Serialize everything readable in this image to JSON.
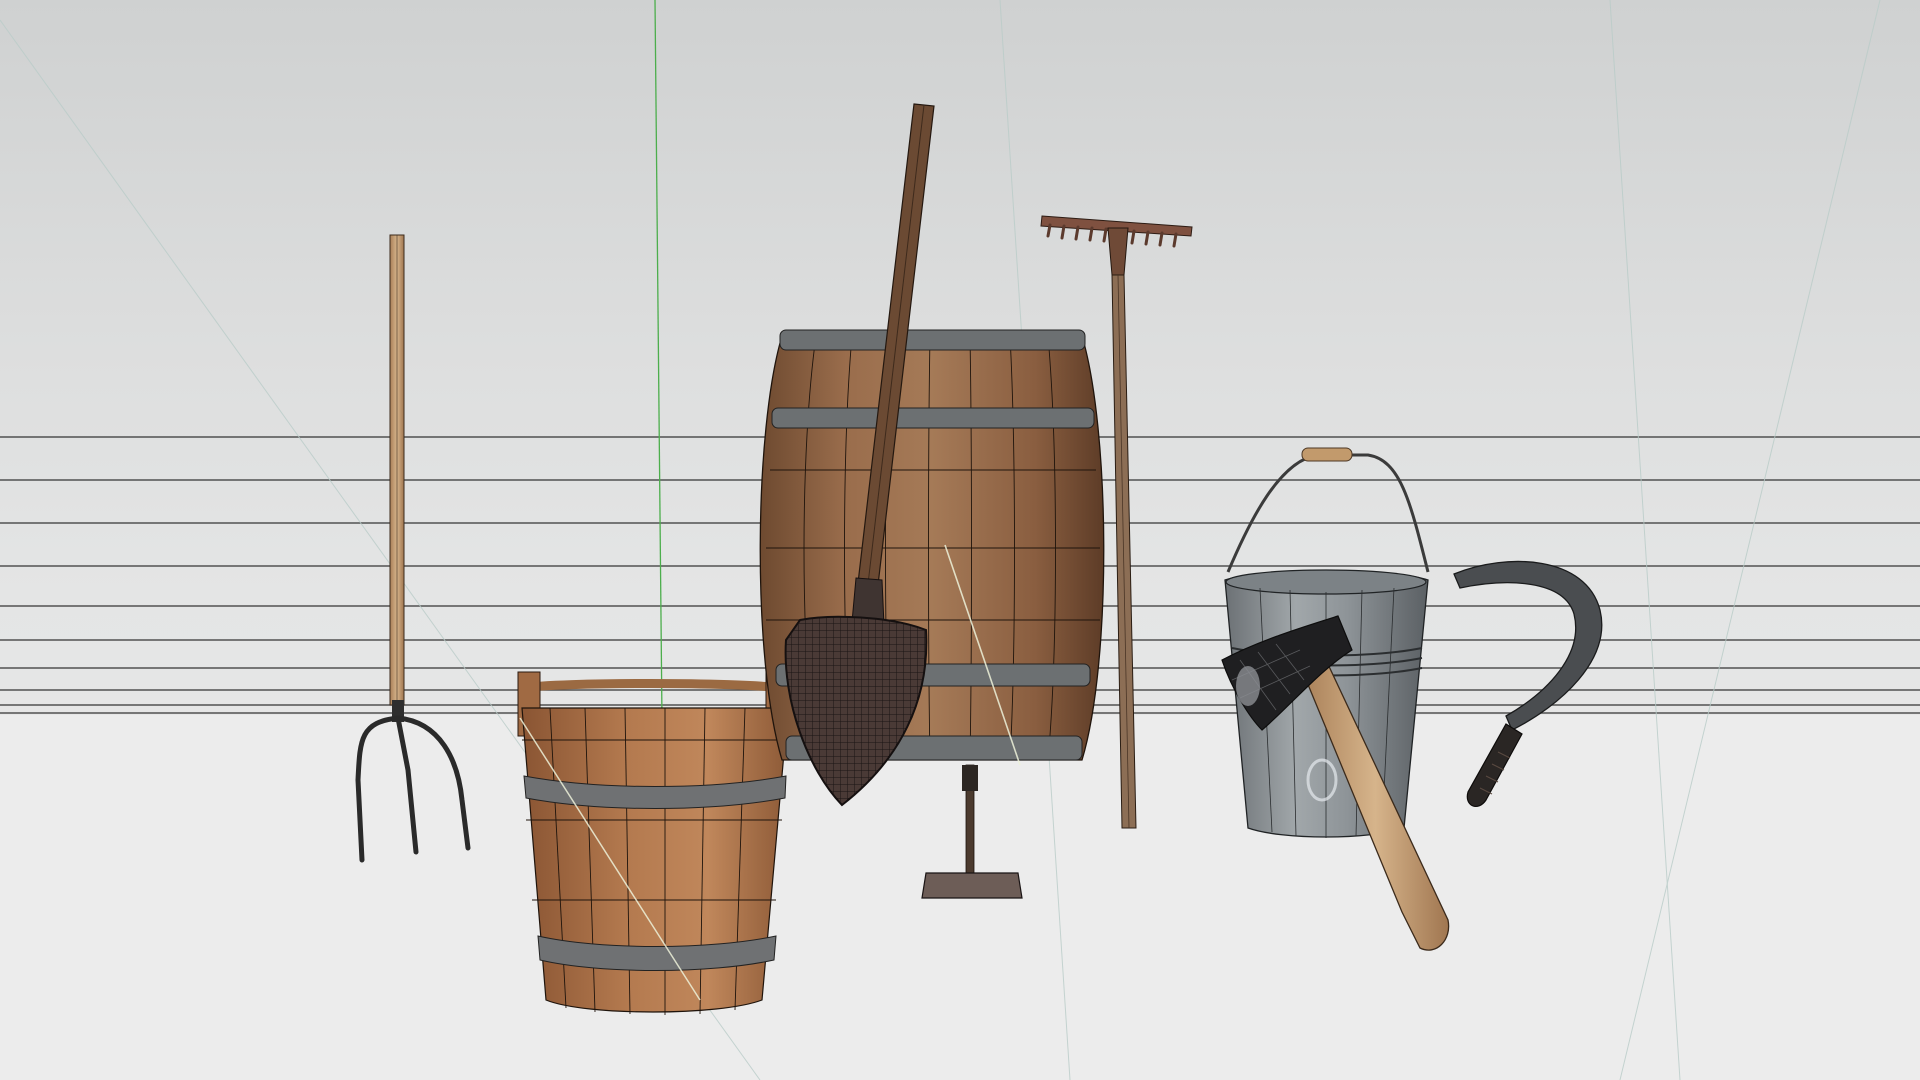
{
  "scene": {
    "background_top": "#cfd1d1",
    "background_mid": "#e2e3e3",
    "floor": "#ececec",
    "wood_light": "#a9744e",
    "wood_dark": "#5e3a24",
    "metal": "#5a5d5e",
    "galvanized": "#9da3a6",
    "handle": "#c9a47a",
    "wireframe": "#1f1f1f",
    "guide_green": "#4cae4c"
  },
  "objects": [
    {
      "name": "pitchfork",
      "icon": "pitchfork-icon"
    },
    {
      "name": "wooden-bucket",
      "icon": "wooden-bucket-icon"
    },
    {
      "name": "barrel",
      "icon": "barrel-icon"
    },
    {
      "name": "shovel",
      "icon": "shovel-icon"
    },
    {
      "name": "hoe",
      "icon": "hoe-icon"
    },
    {
      "name": "rake",
      "icon": "rake-icon"
    },
    {
      "name": "metal-bucket",
      "icon": "metal-bucket-icon"
    },
    {
      "name": "axe",
      "icon": "axe-icon"
    },
    {
      "name": "sickle",
      "icon": "sickle-icon"
    }
  ]
}
